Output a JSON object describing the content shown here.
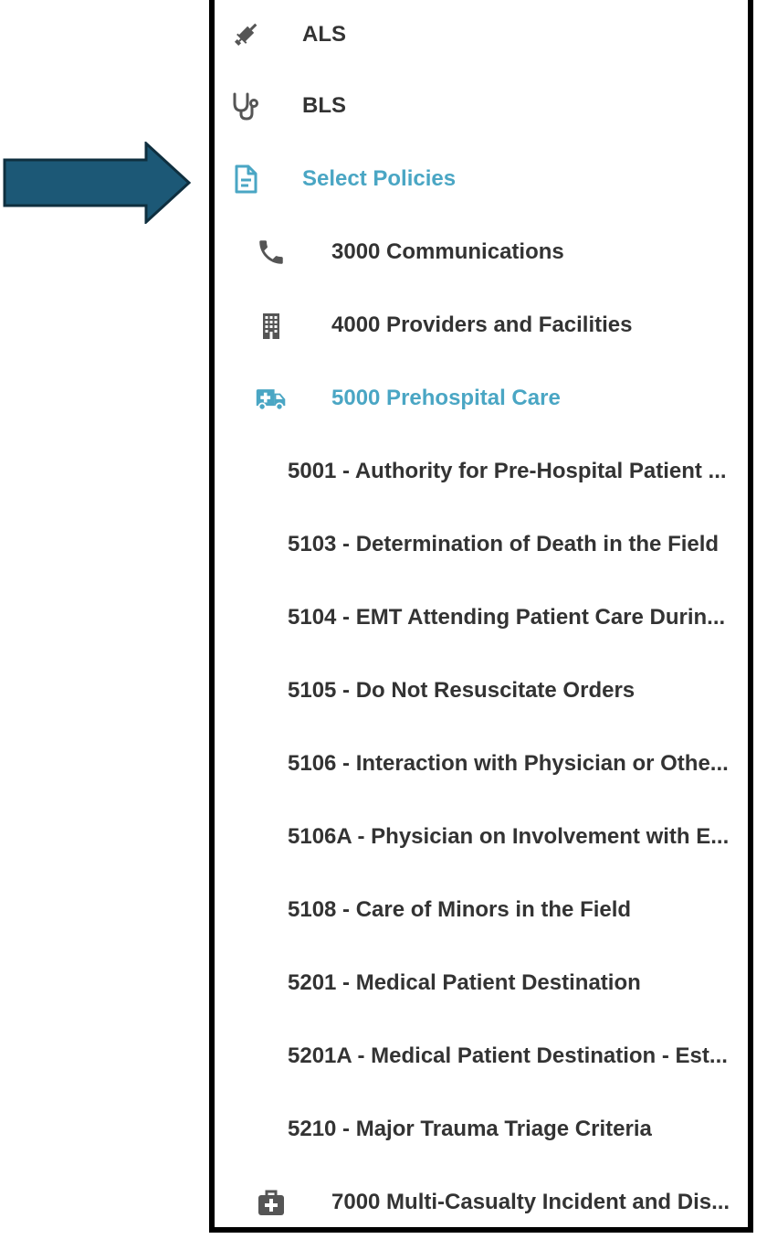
{
  "colors": {
    "accent": "#4aa6c4",
    "text": "#333333",
    "icon": "#555555",
    "arrow": "#1c5876",
    "arrow_border": "#0f2f3f"
  },
  "menu": {
    "top": [
      {
        "label": "ALS",
        "icon": "syringe-icon"
      },
      {
        "label": "BLS",
        "icon": "stethoscope-icon"
      },
      {
        "label": "Select Policies",
        "icon": "document-icon",
        "active": true
      }
    ],
    "policies": [
      {
        "label": "3000 Communications",
        "icon": "phone-icon"
      },
      {
        "label": "4000 Providers and Facilities",
        "icon": "building-icon"
      },
      {
        "label": "5000 Prehospital Care",
        "icon": "ambulance-icon",
        "active": true
      }
    ],
    "prehospital_items": [
      {
        "label": "5001 - Authority for Pre-Hospital Patient ..."
      },
      {
        "label": "5103 - Determination of Death in the Field"
      },
      {
        "label": "5104 - EMT Attending Patient Care Durin..."
      },
      {
        "label": "5105 - Do Not Resuscitate Orders"
      },
      {
        "label": "5106 - Interaction with Physician or Othe..."
      },
      {
        "label": "5106A - Physician on Involvement with E..."
      },
      {
        "label": "5108 - Care of Minors in the Field"
      },
      {
        "label": "5201 - Medical Patient Destination"
      },
      {
        "label": "5201A - Medical Patient Destination - Est..."
      },
      {
        "label": "5210 - Major Trauma Triage Criteria"
      }
    ],
    "bottom": [
      {
        "label": "7000 Multi-Casualty Incident and Dis...",
        "icon": "medical-kit-icon"
      }
    ]
  }
}
